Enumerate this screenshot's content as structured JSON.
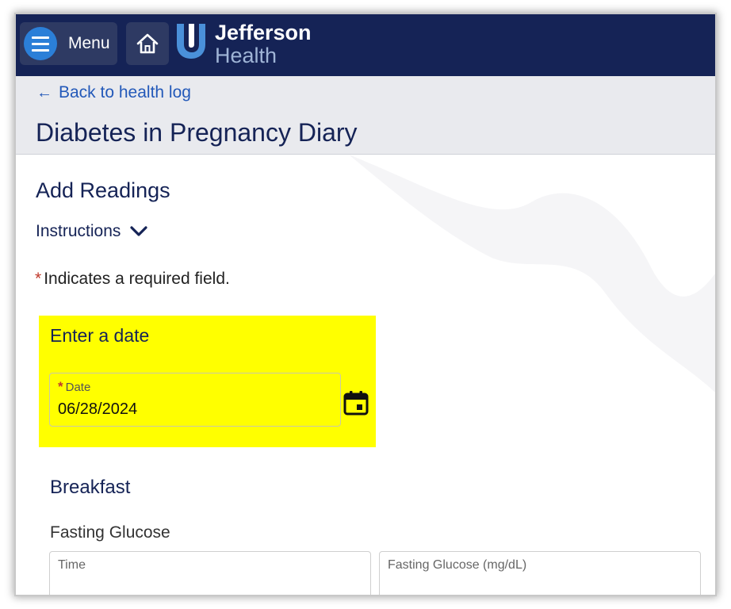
{
  "header": {
    "menu_label": "Menu",
    "logo_line1": "Jefferson",
    "logo_line2": "Health"
  },
  "subheader": {
    "back_link": "Back to health log",
    "page_title": "Diabetes in Pregnancy Diary"
  },
  "main": {
    "section_title": "Add Readings",
    "instructions_label": "Instructions",
    "required_star": "*",
    "required_note": "Indicates a required field.",
    "date_card": {
      "title": "Enter a date",
      "date_label_star": "*",
      "date_label": "Date",
      "date_value": "06/28/2024"
    },
    "breakfast": {
      "title": "Breakfast",
      "fasting_label": "Fasting Glucose",
      "time_placeholder": "Time",
      "glucose_placeholder": "Fasting Glucose (mg/dL)"
    }
  },
  "colors": {
    "navy": "#152356",
    "link_blue": "#2359b9",
    "highlight_yellow": "#ffff00",
    "menu_circle": "#2b7fd8"
  },
  "icons": [
    "hamburger-icon",
    "home-icon",
    "jefferson-logo-icon",
    "arrow-left-icon",
    "chevron-down-icon",
    "calendar-icon"
  ]
}
